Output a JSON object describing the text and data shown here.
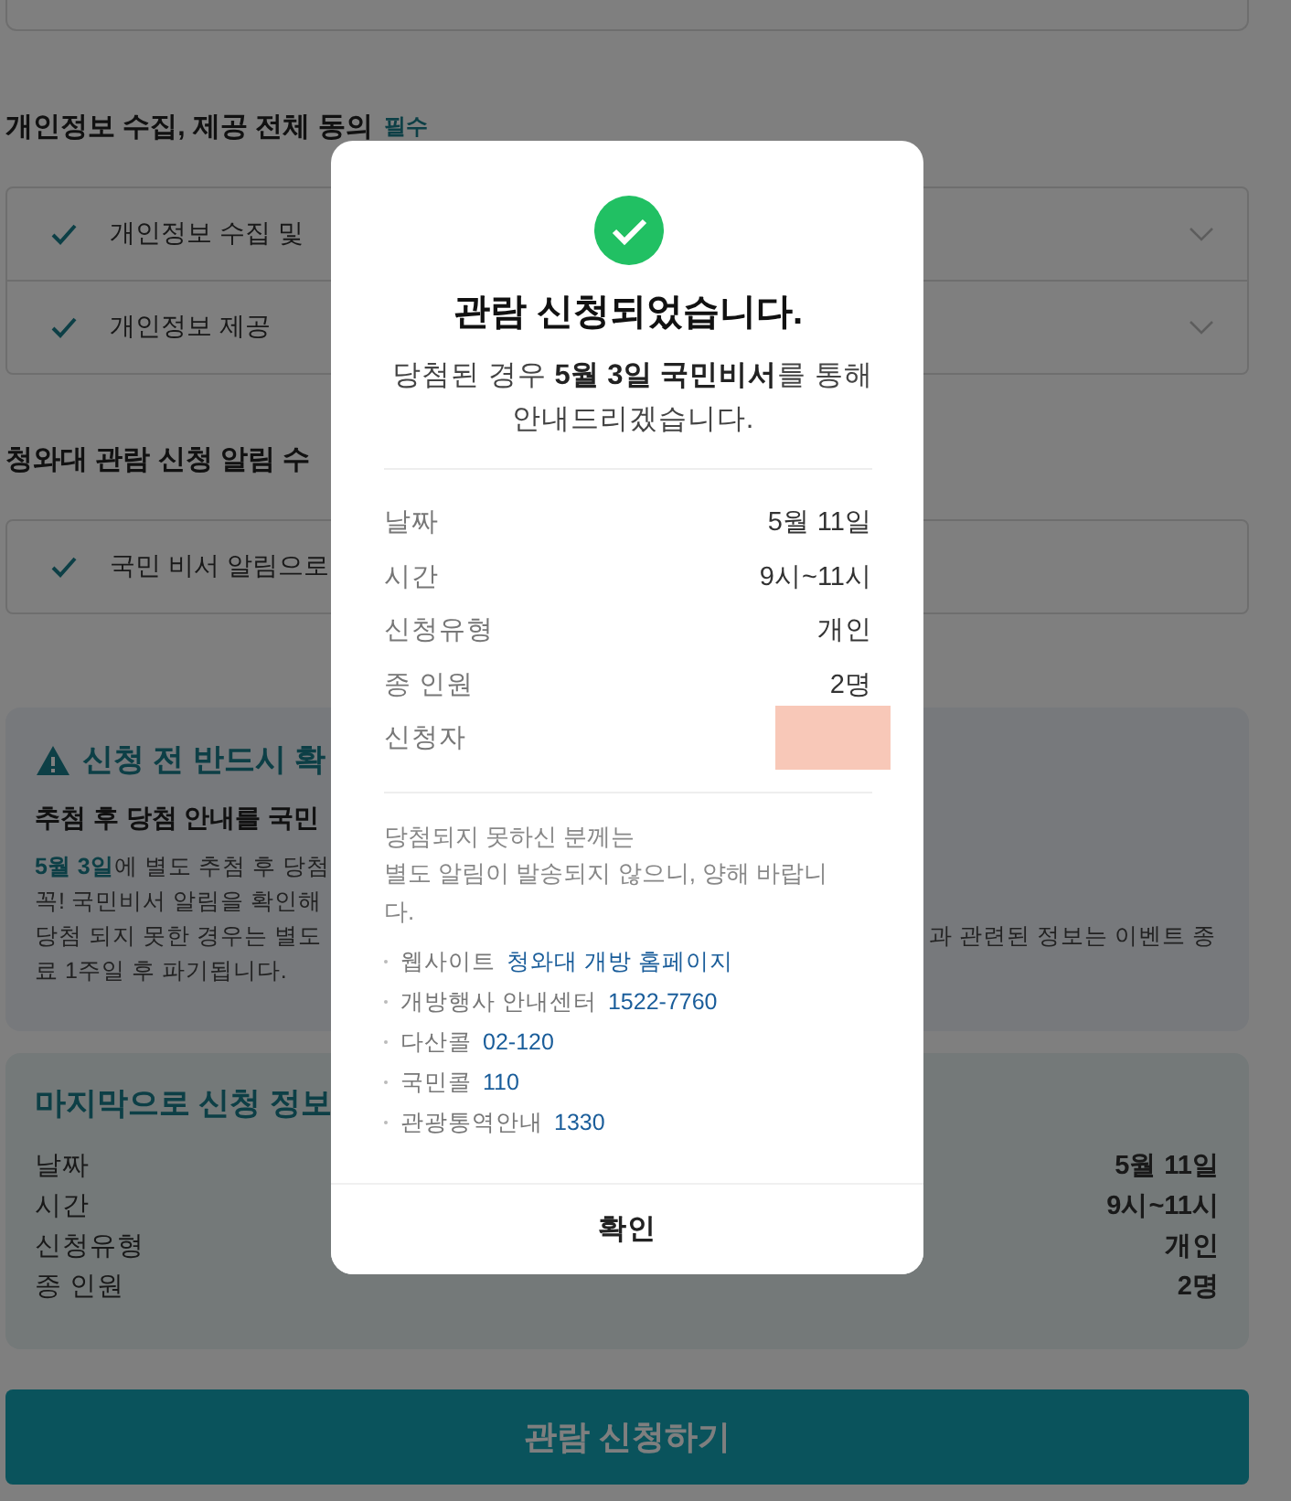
{
  "agreement_section": {
    "title": "개인정보 수집, 제공 전체 동의",
    "badge": "필수",
    "items": [
      {
        "label": "개인정보 수집 및",
        "checked": true,
        "expandable": true
      },
      {
        "label": "개인정보 제공",
        "checked": true,
        "expandable": true
      }
    ]
  },
  "notification_section": {
    "title": "청와대 관람 신청 알림 수",
    "items": [
      {
        "label": "국민 비서 알림으로",
        "checked": true,
        "expandable": false
      }
    ]
  },
  "notice": {
    "title": "신청 전 반드시 확",
    "subtitle": "추첨 후 당첨 안내를 국민",
    "lines": [
      {
        "text": "**5월 3일**에 별도 추첨 후 당첨"
      },
      {
        "text": "꼭! 국민비서 알림을 확인해"
      },
      {
        "text": "당첨 되지 못한 경우는 별도",
        "tail": "과 관련된 정보는 이벤트 종"
      },
      {
        "text": "료 1주일 후 파기됩니다."
      }
    ]
  },
  "summary": {
    "title": "마지막으로 신청 정보",
    "rows": [
      {
        "label": "날짜",
        "value": "5월 11일"
      },
      {
        "label": "시간",
        "value": "9시~11시"
      },
      {
        "label": "신청유형",
        "value": "개인"
      },
      {
        "label": "종 인원",
        "value": "2명"
      }
    ]
  },
  "submit_button": "관람 신청하기",
  "modal": {
    "title": "관람 신청되었습니다.",
    "message": "당첨된 경우 **5월 3일** **국민비서**를 통해 안내드리겠습니다.",
    "details": [
      {
        "label": "날짜",
        "value": "5월 11일"
      },
      {
        "label": "시간",
        "value": "9시~11시"
      },
      {
        "label": "신청유형",
        "value": "개인"
      },
      {
        "label": "종 인원",
        "value": "2명"
      },
      {
        "label": "신청자",
        "redacted": true
      }
    ],
    "note_lines": [
      "당첨되지 못하신 분께는",
      "별도 알림이 발송되지 않으니, 양해 바랍니다."
    ],
    "contacts": [
      {
        "label": "웹사이트",
        "value": "청와대 개방 홈페이지"
      },
      {
        "label": "개방행사 안내센터",
        "value": "1522-7760"
      },
      {
        "label": "다산콜",
        "value": "02-120"
      },
      {
        "label": "국민콜",
        "value": "110"
      },
      {
        "label": "관광통역안내",
        "value": "1330"
      }
    ],
    "confirm_button": "확인"
  }
}
